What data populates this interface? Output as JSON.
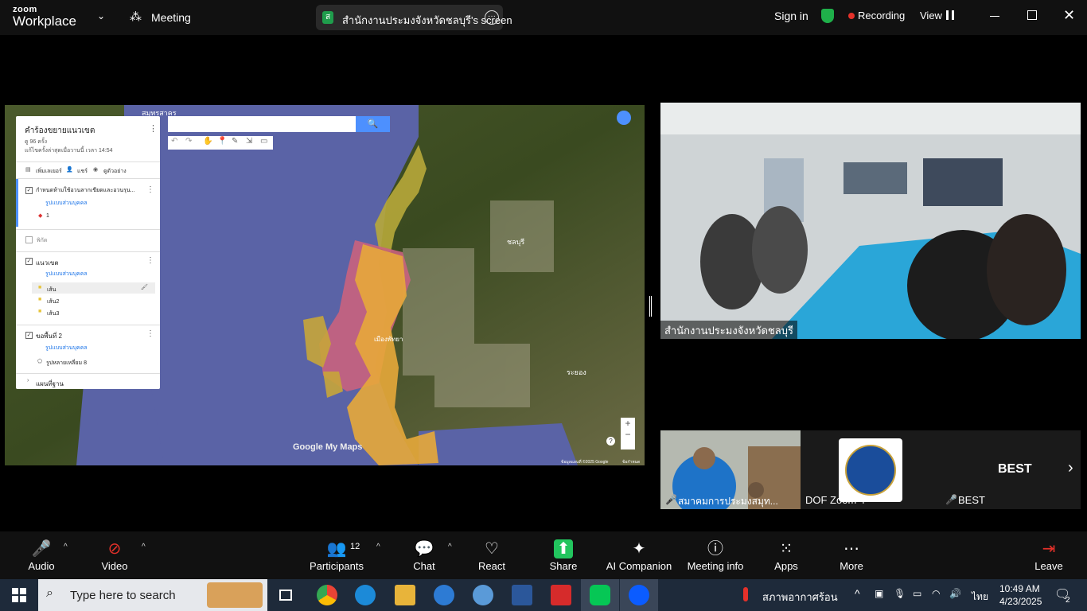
{
  "app": {
    "logo_top": "zoom",
    "logo_bottom": "Workplace"
  },
  "header": {
    "meeting_label": "Meeting",
    "share_badge": "ส",
    "share_title": "สำนักงานประมงจังหวัดชลบุรี's screen",
    "sign_in": "Sign in",
    "recording": "Recording",
    "view": "View"
  },
  "map": {
    "panel_title": "คำร้องขยายแนวเขต",
    "views": "ดู 96 ครั้ง",
    "last_edit": "แก้ไขครั้งล่าสุดเมื่อวานนี้ เวลา 14:54",
    "add_layer": "เพิ่มเลเยอร์",
    "share": "แชร์",
    "preview": "ดูตัวอย่าง",
    "layer1_title": "กำหนดห้ามใช้อวนลากเขียดและอวนรุน...",
    "layer1_style": "รูปแบบส่วนบุคคล",
    "layer1_item": "1",
    "layer2_title": "พิกัด",
    "layer3_title": "แนวเขต",
    "layer3_style": "รูปแบบส่วนบุคคล",
    "layer3_items": [
      "เส้น",
      "เส้น2",
      "เส้น3"
    ],
    "layer4_title": "ขอพื้นที่ 2",
    "layer4_style": "รูปแบบส่วนบุคคล",
    "layer4_item": "รูปหลายเหลี่ยม 8",
    "basemap": "แผนที่ฐาน",
    "label_chonburi": "ชลบุรี",
    "label_rayong": "ระยอง",
    "label_pattaya": "เมืองพัทยา",
    "label_samut": "สมุทรสาคร",
    "watermark": "Google My Maps",
    "copyright": "ข้อมูลแผนที่ ©2025 Google",
    "terms": "ข้อกำหนด"
  },
  "videos": {
    "main_name": "สำนักงานประมงจังหวัดชลบุรี",
    "thumb1_name": "สมาคมการประมงสมุท...",
    "thumb2_name": "DOF Zoom 4",
    "thumb3_center": "BEST",
    "thumb3_name": "BEST"
  },
  "toolbar": {
    "audio": "Audio",
    "video": "Video",
    "participants": "Participants",
    "participants_count": "12",
    "chat": "Chat",
    "react": "React",
    "share": "Share",
    "ai": "AI Companion",
    "info": "Meeting info",
    "apps": "Apps",
    "more": "More",
    "leave": "Leave"
  },
  "taskbar": {
    "search_placeholder": "Type here to search",
    "weather": "สภาพอากาศร้อน",
    "lang": "ไทย",
    "time": "10:49 AM",
    "date": "4/23/2025",
    "notif_count": "2"
  },
  "colors": {
    "zoom_blue": "#0b5cff",
    "share_green": "#22c55e",
    "record_red": "#e5312a",
    "map_sea": "#5a63a6",
    "zone_pink": "#c9627e",
    "zone_yellow": "#e7a93a"
  }
}
